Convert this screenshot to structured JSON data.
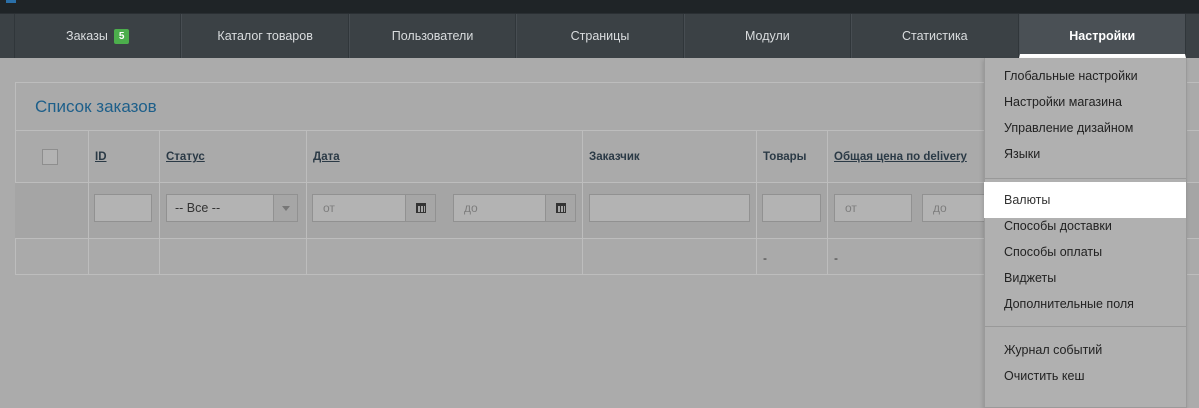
{
  "nav": {
    "items": [
      {
        "label": "Заказы",
        "badge": "5"
      },
      {
        "label": "Каталог товаров"
      },
      {
        "label": "Пользователи"
      },
      {
        "label": "Страницы"
      },
      {
        "label": "Модули"
      },
      {
        "label": "Статистика"
      },
      {
        "label": "Настройки",
        "active": true
      }
    ]
  },
  "panel": {
    "title": "Список заказов",
    "columns": {
      "id": "ID",
      "status": "Статус",
      "date": "Дата",
      "customer": "Заказчик",
      "products": "Товары",
      "total_price": "Общая цена по delivery"
    },
    "filters": {
      "status_value": "-- Все --",
      "date_from_placeholder": "от",
      "date_to_placeholder": "до",
      "price_from_placeholder": "от",
      "price_to_placeholder": "до"
    },
    "totals": {
      "products": "-",
      "total_price": "-"
    }
  },
  "dropdown": {
    "group1": [
      "Глобальные настройки",
      "Настройки магазина",
      "Управление дизайном",
      "Языки"
    ],
    "group2": [
      "Валюты",
      "Способы доставки",
      "Способы оплаты",
      "Виджеты",
      "Дополнительные поля"
    ],
    "group3": [
      "Журнал событий",
      "Очистить кеш"
    ],
    "highlighted": "Валюты"
  },
  "colors": {
    "navbar_bg": "#3b4145",
    "badge_green": "#4cae4c",
    "title_blue": "#1d5f8a",
    "overlay_gray": "#ababab"
  }
}
